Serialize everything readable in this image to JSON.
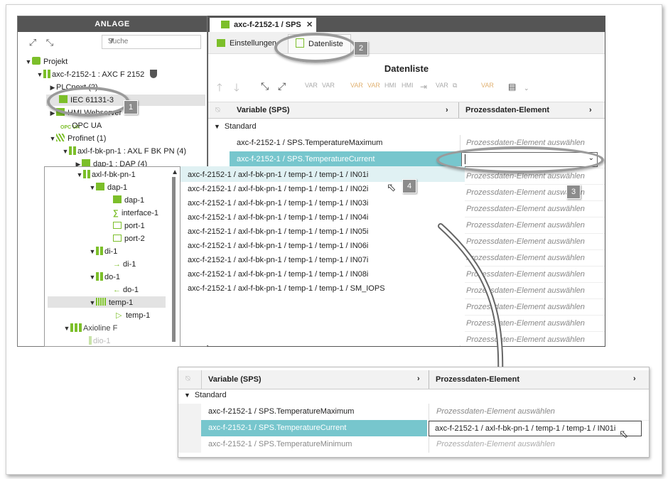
{
  "left_panel": {
    "title": "ANLAGE",
    "search_placeholder": "Suche",
    "tree": [
      {
        "label": "Projekt"
      },
      {
        "label": "axc-f-2152-1 : AXC F 2152"
      },
      {
        "label": "PLCnext (2)"
      },
      {
        "label": "IEC 61131-3"
      },
      {
        "label": "HMI Webserver"
      },
      {
        "label": "OPC UA"
      },
      {
        "label": "Profinet (1)"
      },
      {
        "label": "axl-f-bk-pn-1 : AXL F BK PN (4)"
      },
      {
        "label": "dap-1 : DAP (4)"
      }
    ],
    "subtree": [
      {
        "label": "axl-f-bk-pn-1"
      },
      {
        "label": "dap-1"
      },
      {
        "label": "dap-1"
      },
      {
        "label": "interface-1"
      },
      {
        "label": "port-1"
      },
      {
        "label": "port-2"
      },
      {
        "label": "di-1"
      },
      {
        "label": "di-1"
      },
      {
        "label": "do-1"
      },
      {
        "label": "do-1"
      },
      {
        "label": "temp-1"
      },
      {
        "label": "temp-1"
      },
      {
        "label": "Axioline F"
      },
      {
        "label": "dio-1"
      }
    ]
  },
  "right_panel": {
    "tab_label": "axc-f-2152-1 / SPS",
    "subtab_settings": "Einstellungen",
    "subtab_datalist": "Datenliste",
    "title": "Datenliste",
    "col_variable": "Variable (SPS)",
    "col_process": "Prozessdaten-Element",
    "group": "Standard",
    "rows": [
      {
        "variable": "axc-f-2152-1 / SPS.TemperatureMaximum",
        "process": "Prozessdaten-Element auswählen"
      },
      {
        "variable": "axc-f-2152-1 / SPS.TemperatureCurrent",
        "process": ""
      }
    ],
    "placeholder_rows": [
      "Prozessdaten-Element auswählen",
      "Prozessdaten-Element auswählen",
      "Prozessdaten-Element auswählen",
      "Prozessdaten-Element auswählen",
      "Prozessdaten-Element auswählen",
      "Prozessdaten-Element auswählen",
      "Prozessdaten-Element auswählen",
      "Prozessdaten-Element auswählen",
      "Prozessdaten-Element auswählen",
      "Prozessdaten-Element auswählen",
      "Prozessdaten-Element auswählen",
      "Prozessdaten-Element auswählen"
    ],
    "dropdown_options": [
      "axc-f-2152-1 / axl-f-bk-pn-1 / temp-1 / temp-1 / IN01i",
      "axc-f-2152-1 / axl-f-bk-pn-1 / temp-1 / temp-1 / IN02i",
      "axc-f-2152-1 / axl-f-bk-pn-1 / temp-1 / temp-1 / IN03i",
      "axc-f-2152-1 / axl-f-bk-pn-1 / temp-1 / temp-1 / IN04i",
      "axc-f-2152-1 / axl-f-bk-pn-1 / temp-1 / temp-1 / IN05i",
      "axc-f-2152-1 / axl-f-bk-pn-1 / temp-1 / temp-1 / IN06i",
      "axc-f-2152-1 / axl-f-bk-pn-1 / temp-1 / temp-1 / IN07i",
      "axc-f-2152-1 / axl-f-bk-pn-1 / temp-1 / temp-1 / IN08i",
      "axc-f-2152-1 / axl-f-bk-pn-1 / temp-1 / temp-1 / SM_IOPS"
    ]
  },
  "bottom_panel": {
    "col_variable": "Variable (SPS)",
    "col_process": "Prozessdaten-Element",
    "group": "Standard",
    "rows": [
      {
        "variable": "axc-f-2152-1 / SPS.TemperatureMaximum",
        "process": "Prozessdaten-Element auswählen"
      },
      {
        "variable": "axc-f-2152-1 / SPS.TemperatureCurrent",
        "process": "axc-f-2152-1 / axl-f-bk-pn-1 / temp-1 / temp-1 / IN01i"
      },
      {
        "variable": "axc-f-2152-1 / SPS.TemperatureMinimum",
        "process": "Prozessdaten-Element auswählen"
      }
    ]
  },
  "callouts": [
    "1",
    "2",
    "3",
    "4"
  ],
  "colors": {
    "selection": "#77c6cd",
    "accent_green": "#7cbf2a",
    "header_dark": "#555555",
    "callout_gray": "#8c8c8c"
  }
}
